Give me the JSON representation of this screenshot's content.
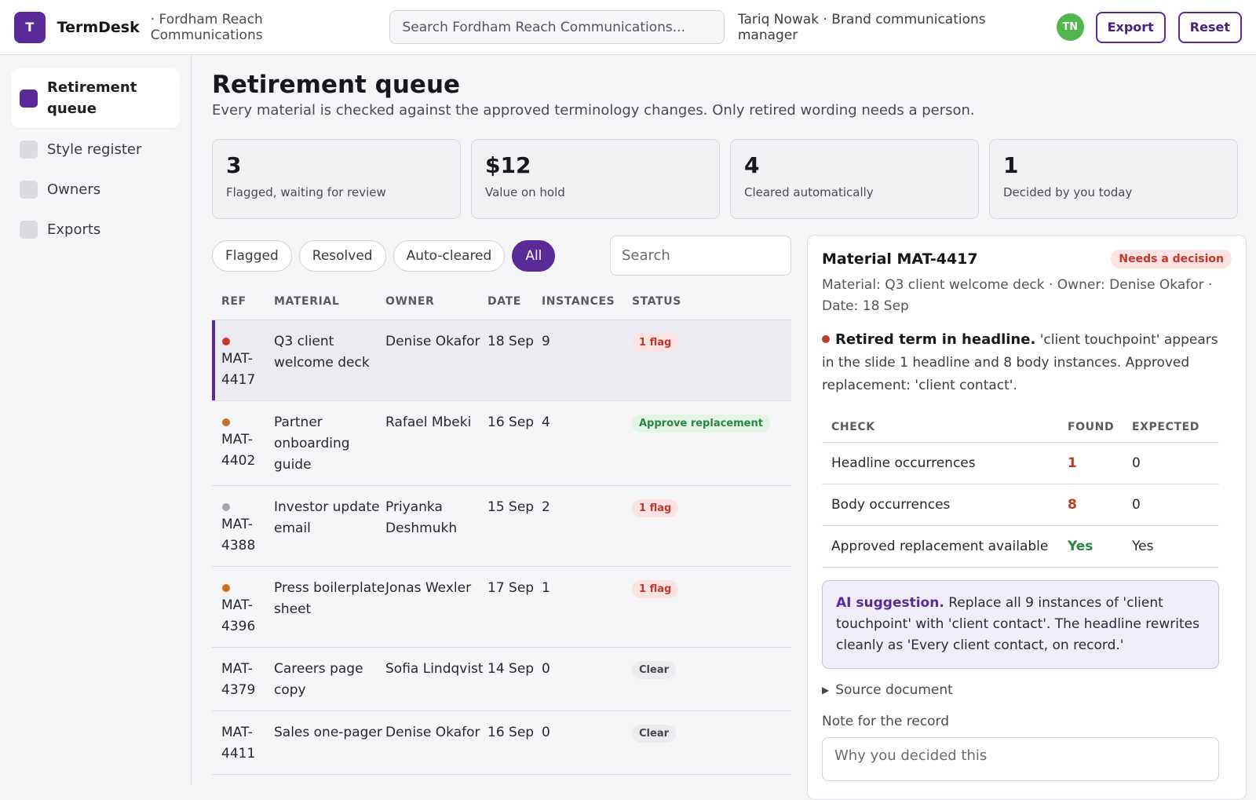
{
  "header": {
    "logo_letter": "T",
    "app_name": "TermDesk",
    "org": "· Fordham Reach Communications",
    "search_placeholder": "Search Fordham Reach Communications...",
    "user": "Tariq Nowak · Brand communications manager",
    "avatar_initials": "TN",
    "export_label": "Export",
    "reset_label": "Reset"
  },
  "sidebar": {
    "items": [
      {
        "label": "Retirement queue",
        "active": true
      },
      {
        "label": "Style register",
        "active": false
      },
      {
        "label": "Owners",
        "active": false
      },
      {
        "label": "Exports",
        "active": false
      }
    ]
  },
  "main": {
    "title": "Retirement queue",
    "subtitle": "Every material is checked against the approved terminology changes. Only retired wording needs a person.",
    "stats": [
      {
        "value": "3",
        "label": "Flagged, waiting for review"
      },
      {
        "value": "$12",
        "label": "Value on hold"
      },
      {
        "value": "4",
        "label": "Cleared automatically"
      },
      {
        "value": "1",
        "label": "Decided by you today"
      }
    ],
    "filters": [
      "Flagged",
      "Resolved",
      "Auto-cleared",
      "All"
    ],
    "active_filter": "All",
    "table_search_placeholder": "Search",
    "columns": [
      "REF",
      "MATERIAL",
      "OWNER",
      "DATE",
      "INSTANCES",
      "STATUS"
    ],
    "rows": [
      {
        "ref": "MAT-4417",
        "material": "Q3 client welcome deck",
        "owner": "Denise Okafor",
        "date": "18 Sep",
        "instances": "9",
        "status": "1 flag",
        "status_kind": "flag",
        "dot": "red",
        "selected": true
      },
      {
        "ref": "MAT-4402",
        "material": "Partner onboarding guide",
        "owner": "Rafael Mbeki",
        "date": "16 Sep",
        "instances": "4",
        "status": "Approve replacement",
        "status_kind": "ok",
        "dot": "orange",
        "selected": false
      },
      {
        "ref": "MAT-4388",
        "material": "Investor update email",
        "owner": "Priyanka Deshmukh",
        "date": "15 Sep",
        "instances": "2",
        "status": "1 flag",
        "status_kind": "flag",
        "dot": "gray",
        "selected": false
      },
      {
        "ref": "MAT-4396",
        "material": "Press boilerplate sheet",
        "owner": "Jonas Wexler",
        "date": "17 Sep",
        "instances": "1",
        "status": "1 flag",
        "status_kind": "flag",
        "dot": "orange",
        "selected": false
      },
      {
        "ref": "MAT-4379",
        "material": "Careers page copy",
        "owner": "Sofia Lindqvist",
        "date": "14 Sep",
        "instances": "0",
        "status": "Clear",
        "status_kind": "clear",
        "dot": "",
        "selected": false
      },
      {
        "ref": "MAT-4411",
        "material": "Sales one-pager",
        "owner": "Denise Okafor",
        "date": "16 Sep",
        "instances": "0",
        "status": "Clear",
        "status_kind": "clear",
        "dot": "",
        "selected": false
      }
    ]
  },
  "detail": {
    "title": "Material MAT-4417",
    "badge": "Needs a decision",
    "meta": "Material: Q3 client welcome deck · Owner: Denise Okafor · Date: 18 Sep",
    "issue_title": "Retired term in headline.",
    "issue_text": " 'client touchpoint' appears in the slide 1 headline and 8 body instances. Approved replacement: 'client contact'.",
    "check_columns": [
      "CHECK",
      "FOUND",
      "EXPECTED"
    ],
    "checks": [
      {
        "name": "Headline occurrences",
        "found": "1",
        "expected": "0",
        "found_kind": "red"
      },
      {
        "name": "Body occurrences",
        "found": "8",
        "expected": "0",
        "found_kind": "red"
      },
      {
        "name": "Approved replacement available",
        "found": "Yes",
        "expected": "Yes",
        "found_kind": "green"
      }
    ],
    "ai_label": "AI suggestion.",
    "ai_text": " Replace all 9 instances of 'client touchpoint' with 'client contact'. The headline rewrites cleanly as 'Every client contact, on record.'",
    "source_label": "Source document",
    "note_label": "Note for the record",
    "note_placeholder": "Why you decided this"
  },
  "colors": {
    "accent": "#5b2a99",
    "flag_red": "#c0392b",
    "ok_green": "#2e8540",
    "avatar_green": "#52b54e"
  }
}
